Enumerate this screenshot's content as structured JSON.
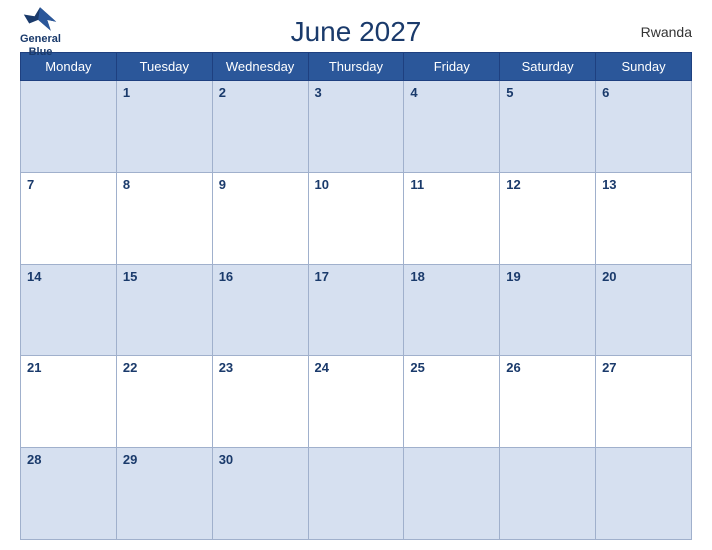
{
  "header": {
    "title": "June 2027",
    "country": "Rwanda",
    "logo_line1": "General",
    "logo_line2": "Blue"
  },
  "weekdays": [
    "Monday",
    "Tuesday",
    "Wednesday",
    "Thursday",
    "Friday",
    "Saturday",
    "Sunday"
  ],
  "weeks": [
    [
      null,
      1,
      2,
      3,
      4,
      5,
      6
    ],
    [
      7,
      8,
      9,
      10,
      11,
      12,
      13
    ],
    [
      14,
      15,
      16,
      17,
      18,
      19,
      20
    ],
    [
      21,
      22,
      23,
      24,
      25,
      26,
      27
    ],
    [
      28,
      29,
      30,
      null,
      null,
      null,
      null
    ]
  ]
}
